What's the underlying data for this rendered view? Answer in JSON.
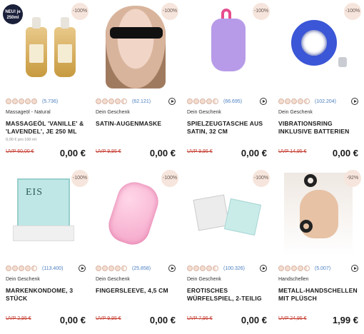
{
  "products": [
    {
      "badge": "-100%",
      "new_badge": "NEU! je 250ml",
      "rating_count": "(5.736)",
      "category": "Massageöl - Natural",
      "title": "MASSAGEÖL 'VANILLE' & 'LAVENDEL', JE 250 ML",
      "sub_price": "0,00 € pro 100 ml",
      "old_price": "UVP 60,00 €",
      "price": "0,00 €",
      "art": "massage-oil-bottles"
    },
    {
      "badge": "-100%",
      "rating_count": "(62.121)",
      "category": "Dein Geschenk",
      "title": "SATIN-AUGENMASKE",
      "old_price": "UVP 9,95 €",
      "price": "0,00 €",
      "art": "eye-mask"
    },
    {
      "badge": "-100%",
      "rating_count": "(66.695)",
      "category": "Dein Geschenk",
      "title": "SPIELZEUGTASCHE AUS SATIN, 32 CM",
      "old_price": "UVP 9,95 €",
      "price": "0,00 €",
      "art": "toy-bag"
    },
    {
      "badge": "-100%",
      "rating_count": "(102.204)",
      "category": "Dein Geschenk",
      "title": "VIBRATIONSRING INKLUSIVE BATTERIEN",
      "old_price": "UVP 14,95 €",
      "price": "0,00 €",
      "art": "vibration-ring"
    },
    {
      "badge": "-100%",
      "rating_count": "(113.400)",
      "category": "Dein Geschenk",
      "title": "MARKENKONDOME, 3 STÜCK",
      "old_price": "UVP 2,95 €",
      "price": "0,00 €",
      "art": "condoms",
      "box_text": "EIS"
    },
    {
      "badge": "-100%",
      "rating_count": "(25.858)",
      "category": "Dein Geschenk",
      "title": "FINGERSLEEVE, 4,5 CM",
      "old_price": "UVP 9,95 €",
      "price": "0,00 €",
      "art": "finger-sleeve"
    },
    {
      "badge": "-100%",
      "rating_count": "(100.326)",
      "category": "Dein Geschenk",
      "title": "EROTISCHES WÜRFELSPIEL, 2-TEILIG",
      "old_price": "UVP 7,95 €",
      "price": "0,00 €",
      "art": "dice-game"
    },
    {
      "badge": "-92%",
      "rating_count": "(5.007)",
      "category": "Handschellen",
      "title": "METALL-HANDSCHELLEN MIT PLÜSCH",
      "old_price": "UVP 24,95 €",
      "price": "1,99 €",
      "art": "handcuffs"
    }
  ]
}
